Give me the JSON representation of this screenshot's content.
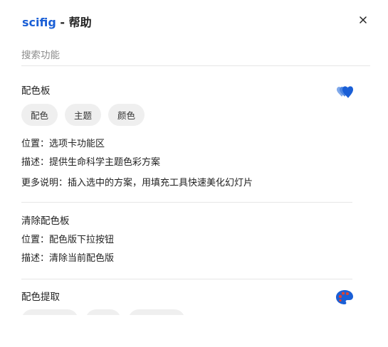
{
  "header": {
    "brand": "scifig",
    "separator": " - ",
    "title": "帮助",
    "close_glyph": "×"
  },
  "search": {
    "placeholder": "搜索功能",
    "value": ""
  },
  "sections": [
    {
      "title": "配色板",
      "icon": "palette-hearts-icon",
      "chips": [
        "配色",
        "主题",
        "颜色"
      ],
      "location": "位置：选项卡功能区",
      "description": "描述：提供生命科学主题色彩方案",
      "more": "更多说明：插入选中的方案，用填充工具快速美化幻灯片"
    },
    {
      "title": "清除配色板",
      "location": "位置：配色版下拉按钮",
      "description": "描述：清除当前配色版"
    },
    {
      "title": "配色提取",
      "icon": "paint-palette-icon",
      "chips": [
        "",
        "",
        ""
      ]
    }
  ],
  "colors": {
    "brand": "#1a5fd6",
    "icon_blue": "#1a5fd6",
    "icon_red": "#e0412f"
  }
}
